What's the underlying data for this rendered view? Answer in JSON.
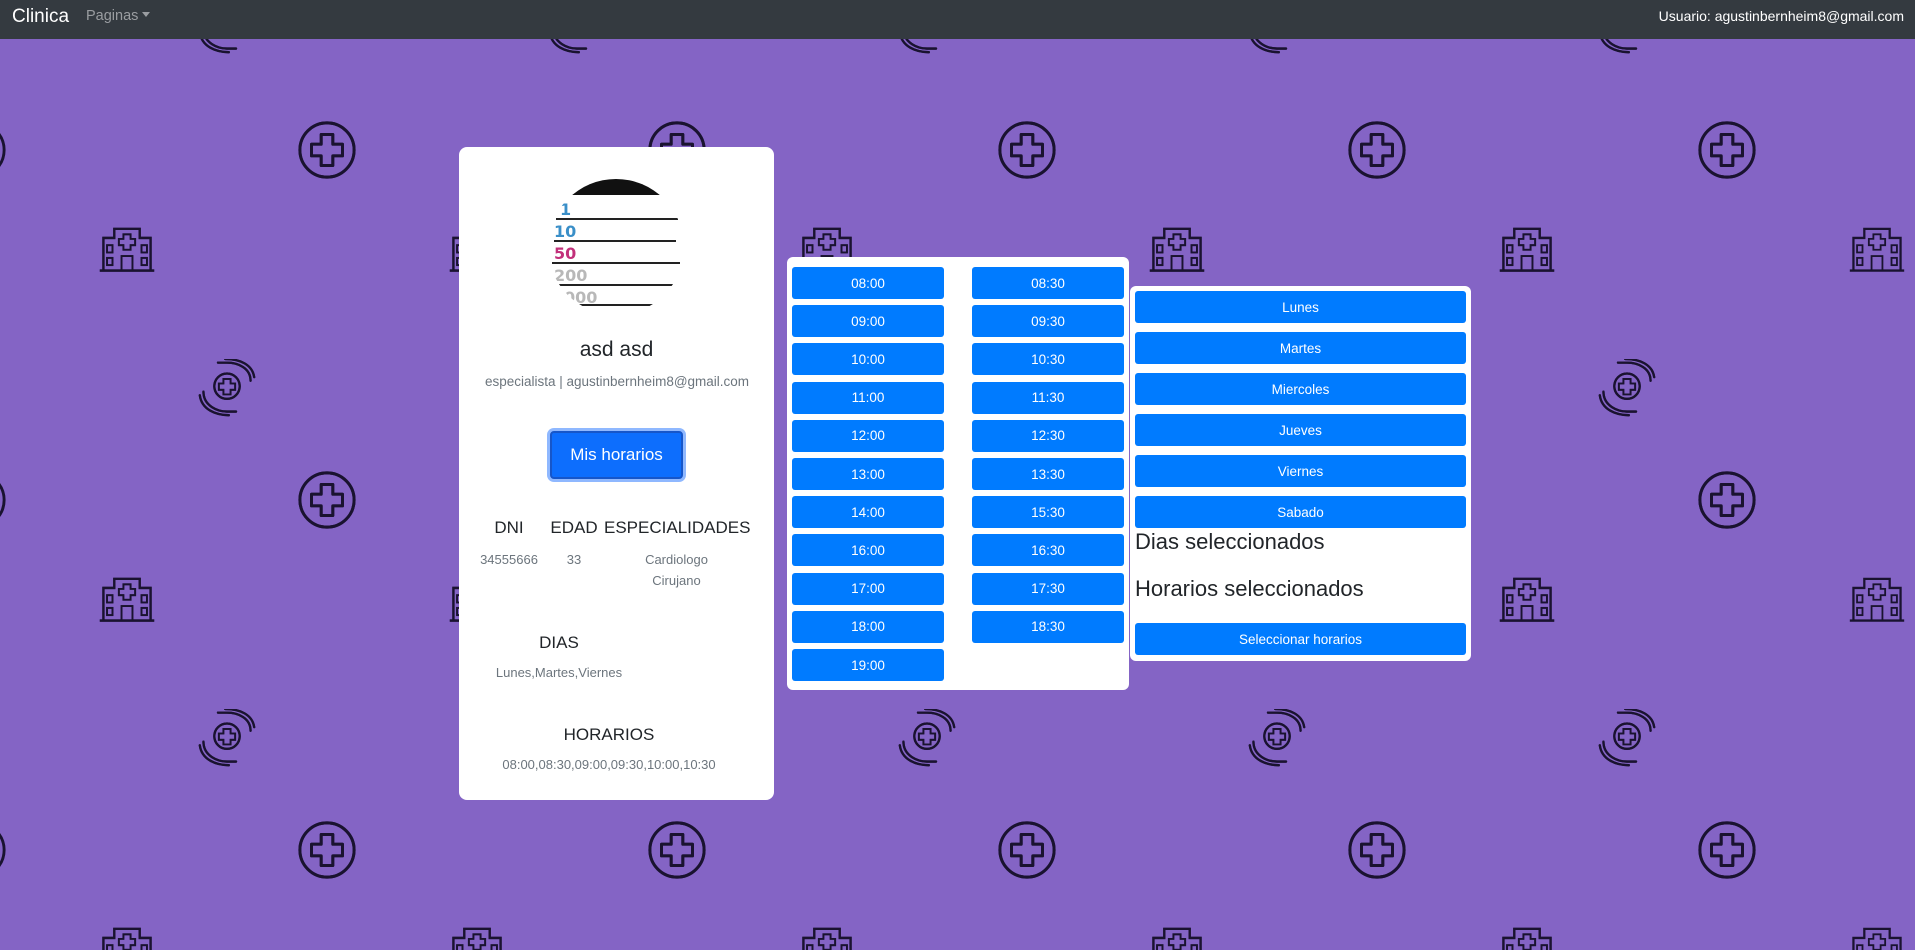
{
  "nav": {
    "brand": "Clinica",
    "pages_label": "Paginas",
    "user_label": "Usuario: agustinbernheim8@gmail.com"
  },
  "profile": {
    "name": "asd asd",
    "info": "especialista | agustinbernheim8@gmail.com",
    "button": "Mis horarios",
    "dni_label": "DNI",
    "dni_value": "34555666",
    "edad_label": "EDAD",
    "edad_value": "33",
    "especialidades_label": "ESPECIALIDADES",
    "especialidades": [
      "Cardiologo",
      "Cirujano"
    ],
    "dias_label": "DIAS",
    "dias_value": "Lunes,Martes,Viernes",
    "horarios_label": "HORARIOS",
    "horarios_value": "08:00,08:30,09:00,09:30,10:00,10:30",
    "avatar_numbers": [
      "1",
      "10",
      "50",
      "200",
      "000"
    ]
  },
  "time_slots": {
    "left": [
      "08:00",
      "09:00",
      "10:00",
      "11:00",
      "12:00",
      "13:00",
      "14:00",
      "16:00",
      "17:00",
      "18:00",
      "19:00"
    ],
    "right": [
      "08:30",
      "09:30",
      "10:30",
      "11:30",
      "12:30",
      "13:30",
      "15:30",
      "16:30",
      "17:30",
      "18:30"
    ]
  },
  "days": [
    "Lunes",
    "Martes",
    "Miercoles",
    "Jueves",
    "Viernes",
    "Sabado"
  ],
  "selection": {
    "dias_title": "Dias seleccionados",
    "horarios_title": "Horarios seleccionados",
    "submit": "Seleccionar horarios"
  },
  "colors": {
    "background": "#8464c5",
    "navbar": "#343a40",
    "primary": "#007bff",
    "icon_stroke": "#1a1330"
  },
  "background_icons": [
    "plus-circle-icon",
    "hospital-icon",
    "care-hands-icon"
  ]
}
